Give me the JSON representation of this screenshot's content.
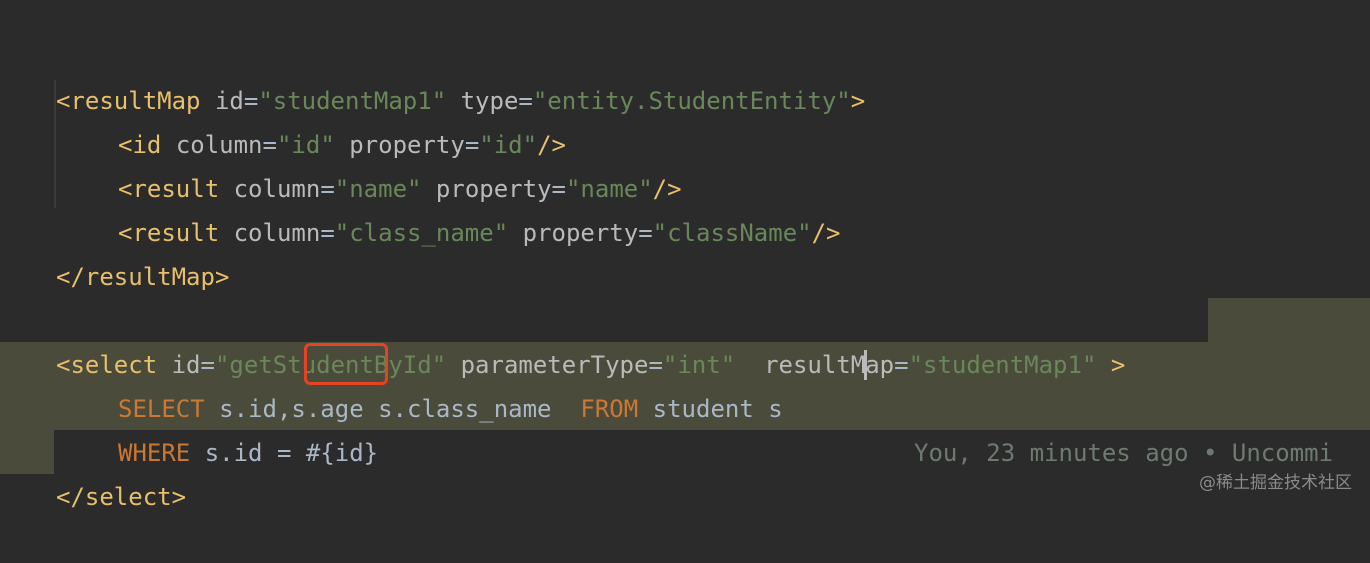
{
  "code": {
    "line1": {
      "open": "<resultMap",
      "attr1": "id",
      "val1": "\"studentMap1\"",
      "attr2": "type",
      "val2": "\"entity.StudentEntity\"",
      "close": ">"
    },
    "line2": {
      "open": "<id",
      "attr1": "column",
      "val1": "\"id\"",
      "attr2": "property",
      "val2": "\"id\"",
      "close": "/>"
    },
    "line3": {
      "open": "<result",
      "attr1": "column",
      "val1": "\"name\"",
      "attr2": "property",
      "val2": "\"name\"",
      "close": "/>"
    },
    "line4": {
      "open": "<result",
      "attr1": "column",
      "val1": "\"class_name\"",
      "attr2": "property",
      "val2": "\"className\"",
      "close": "/>"
    },
    "line5": {
      "close_tag": "</resultMap>"
    },
    "line7": {
      "open": "<select",
      "attr1": "id",
      "val1": "\"getStudentById\"",
      "attr2": "parameterType",
      "val2": "\"int\"",
      "attr3": "resultMap",
      "val3": "\"studentMap1\"",
      "close": ">"
    },
    "line8": {
      "kw_select": "SELECT",
      "col1": "s.id,",
      "col2": "s.age",
      "col3": "s.class_name",
      "kw_from": "FROM",
      "table": "student s"
    },
    "line9": {
      "kw_where": "WHERE",
      "cond": "s.id = #{id}"
    },
    "line10": {
      "close_tag": "</select>"
    }
  },
  "blame": "You, 23 minutes ago • Uncommi",
  "watermark": "@稀土掘金技术社区",
  "colors": {
    "background": "#2b2b2b",
    "tag": "#e8bf6a",
    "string": "#6a8759",
    "keyword": "#cc7832",
    "highlight": "#4b4b3b",
    "annotation_box": "#e44326"
  }
}
